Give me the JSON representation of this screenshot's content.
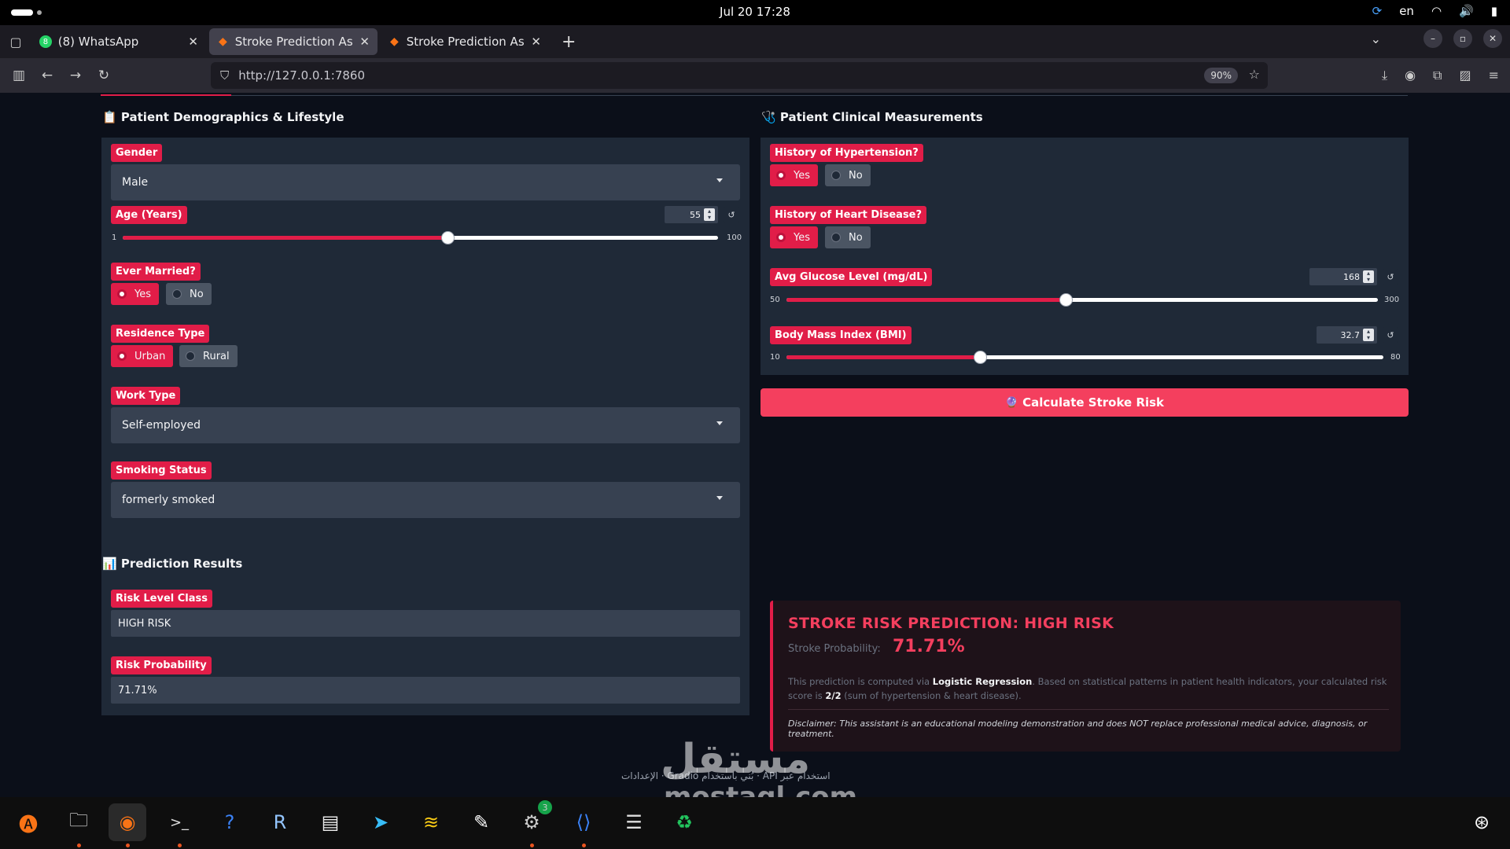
{
  "system": {
    "clock": "Jul 20  17:28",
    "lang": "en"
  },
  "browser": {
    "tabs": [
      {
        "label": "(8) WhatsApp",
        "badge": "8"
      },
      {
        "label": "Stroke Prediction Assista"
      },
      {
        "label": "Stroke Prediction Assista"
      }
    ],
    "url": "http://127.0.0.1:7860",
    "zoom": "90%"
  },
  "left": {
    "section_title": "Patient Demographics & Lifestyle",
    "gender": {
      "label": "Gender",
      "value": "Male"
    },
    "age": {
      "label": "Age (Years)",
      "value": "55",
      "min": "1",
      "max": "100",
      "level": 0.545
    },
    "married": {
      "label": "Ever Married?",
      "yes": "Yes",
      "no": "No",
      "selected": "Yes"
    },
    "residence": {
      "label": "Residence Type",
      "opt1": "Urban",
      "opt2": "Rural",
      "selected": "Urban"
    },
    "work": {
      "label": "Work Type",
      "value": "Self-employed"
    },
    "smoking": {
      "label": "Smoking Status",
      "value": "formerly smoked"
    }
  },
  "right": {
    "section_title": "Patient Clinical Measurements",
    "hypertension": {
      "label": "History of Hypertension?",
      "yes": "Yes",
      "no": "No",
      "selected": "Yes"
    },
    "heart": {
      "label": "History of Heart Disease?",
      "yes": "Yes",
      "no": "No",
      "selected": "Yes"
    },
    "glucose": {
      "label": "Avg Glucose Level (mg/dL)",
      "value": "168",
      "min": "50",
      "max": "300",
      "level": 0.472
    },
    "bmi": {
      "label": "Body Mass Index (BMI)",
      "value": "32.7",
      "min": "10",
      "max": "80",
      "level": 0.324
    },
    "calc_button": "Calculate Stroke Risk"
  },
  "results": {
    "section_title": "Prediction Results",
    "risk_class_label": "Risk Level Class",
    "risk_class_value": "HIGH RISK",
    "risk_prob_label": "Risk Probability",
    "risk_prob_value": "71.71%"
  },
  "card": {
    "heading": "STROKE RISK PREDICTION: HIGH RISK",
    "prob_label": "Stroke Probability:",
    "prob_value": "71.71%",
    "desc_1": "This prediction is computed via ",
    "desc_model": "Logistic Regression",
    "desc_2": ". Based on statistical patterns in patient health indicators, your calculated risk score is ",
    "desc_score": "2/2",
    "desc_3": " (sum of hypertension & heart disease).",
    "disclaimer": "Disclaimer: This assistant is an educational modeling demonstration and does NOT replace professional medical advice, diagnosis, or treatment."
  },
  "footer": {
    "text": "استخدام عبر API  ·  بُني باستخدام Gradio  ·  الإعدادات"
  },
  "watermark": {
    "line1": "مستقل",
    "line2": "mostaql.com"
  },
  "colors": {
    "accent": "#e11d48",
    "button": "#f43f5e",
    "panel": "#1f2937",
    "input": "#374151",
    "page_bg": "#0b0f19"
  }
}
